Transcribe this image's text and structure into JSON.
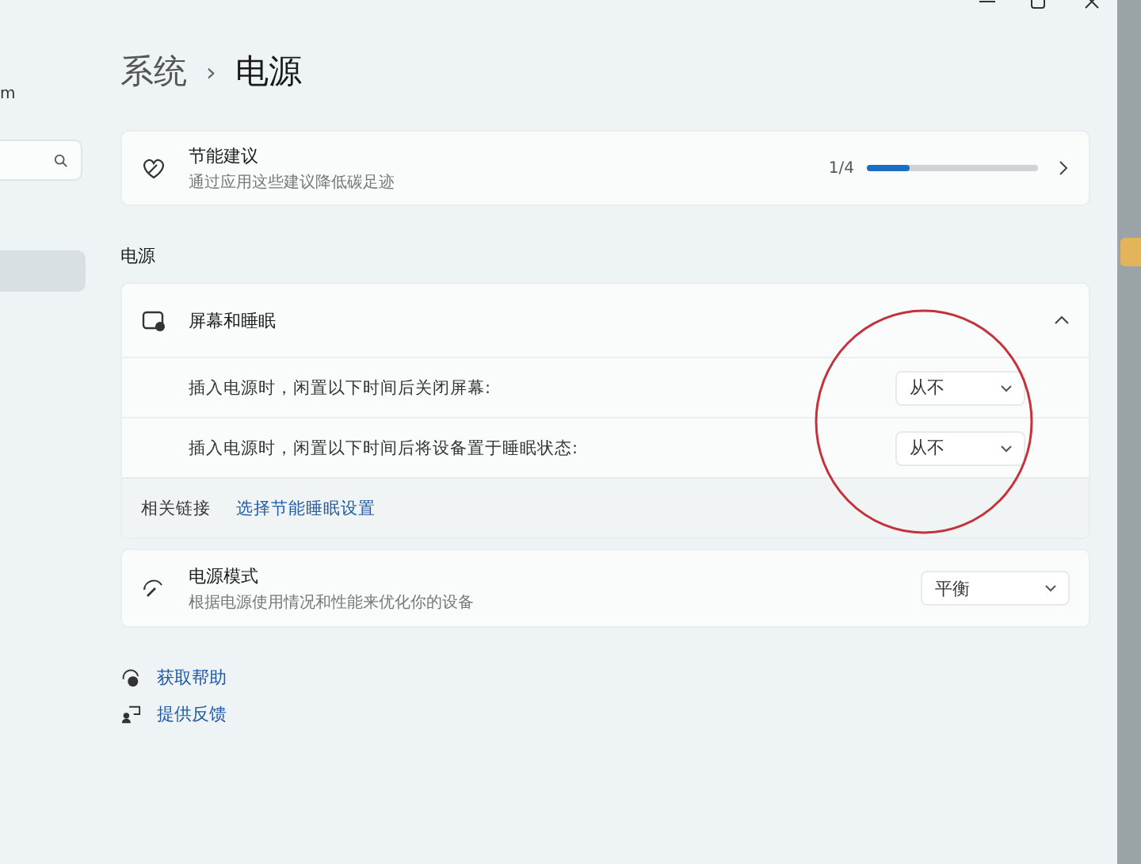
{
  "sidebar": {
    "account_text": "m",
    "items": [
      {
        "selected": true
      }
    ]
  },
  "breadcrumb": {
    "parent": "系统",
    "separator": "›",
    "current": "电源"
  },
  "recommendations": {
    "title": "节能建议",
    "subtitle": "通过应用这些建议降低碳足迹",
    "count": "1/4",
    "level": 0.25
  },
  "section_label": "电源",
  "screen_sleep": {
    "title": "屏幕和睡眠",
    "expanded": true,
    "settings": [
      {
        "label": "插入电源时，闲置以下时间后关闭屏幕:",
        "value": "从不"
      },
      {
        "label": "插入电源时，闲置以下时间后将设备置于睡眠状态:",
        "value": "从不"
      }
    ],
    "related_label": "相关链接",
    "related_link": "选择节能睡眠设置"
  },
  "power_mode": {
    "title": "电源模式",
    "subtitle": "根据电源使用情况和性能来优化你的设备",
    "value": "平衡"
  },
  "footer_links": [
    {
      "kind": "help",
      "label": "获取帮助"
    },
    {
      "kind": "feedback",
      "label": "提供反馈"
    }
  ]
}
